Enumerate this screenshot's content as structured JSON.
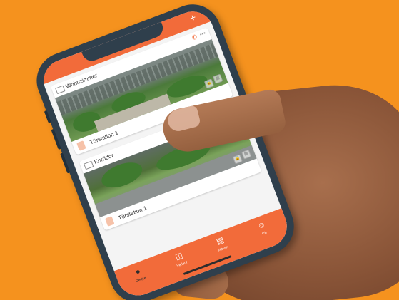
{
  "status_bar": {
    "plus_icon": "plus-icon"
  },
  "cards": [
    {
      "title": "Wohnzimmer",
      "call_icon": "phone-icon",
      "more_icon": "more-icon",
      "station_label": "Türstation 1"
    },
    {
      "title": "Korridor",
      "call_icon": "phone-icon",
      "more_icon": "more-icon",
      "station_label": "Türstation 1"
    }
  ],
  "tabs": [
    {
      "label": "Geräte",
      "icon": "device-icon",
      "active": true
    },
    {
      "label": "Verlauf",
      "icon": "history-icon",
      "active": false
    },
    {
      "label": "Album",
      "icon": "album-icon",
      "active": false
    },
    {
      "label": "Ich",
      "icon": "profile-icon",
      "active": false
    }
  ],
  "colors": {
    "background": "#f5921e",
    "accent": "#f26b3a",
    "phone_frame": "#2f3f4c"
  }
}
